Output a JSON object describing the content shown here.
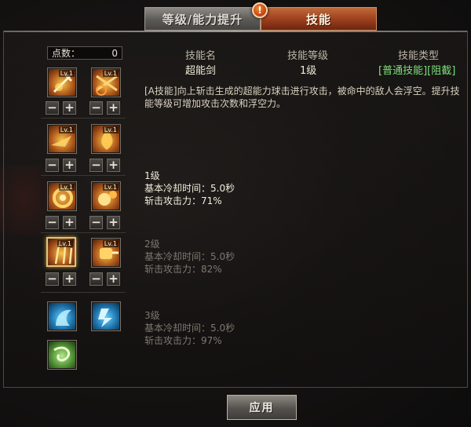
{
  "tabs": {
    "upgrade_label": "等级/能力提升",
    "skills_label": "技能",
    "alert": "!"
  },
  "points": {
    "label": "点数：",
    "value": "0"
  },
  "skill_info": {
    "name_header": "技能名",
    "level_header": "技能等级",
    "type_header": "技能类型",
    "name_value": "超能剑",
    "level_value": "1级",
    "type_value": "[普通技能][阻截]",
    "description": "[A技能]向上斩击生成的超能力球击进行攻击，被命中的敌人会浮空。提升技能等级可增加攻击次数和浮空力。"
  },
  "levels": [
    {
      "title": "1级",
      "cooldown": "基本冷却时间：5.0秒",
      "attack": "斩击攻击力：71%"
    },
    {
      "title": "2级",
      "cooldown": "基本冷却时间：5.0秒",
      "attack": "斩击攻击力：82%"
    },
    {
      "title": "3级",
      "cooldown": "基本冷却时间：5.0秒",
      "attack": "斩击攻击力：97%"
    }
  ],
  "skill_icons": [
    {
      "name": "skill-1",
      "level": "Lv.1",
      "color": "fire"
    },
    {
      "name": "skill-2",
      "level": "Lv.1",
      "color": "fire"
    },
    {
      "name": "skill-3",
      "level": "Lv.1",
      "color": "fire"
    },
    {
      "name": "skill-4",
      "level": "Lv.1",
      "color": "fire"
    },
    {
      "name": "skill-5",
      "level": "Lv.1",
      "color": "fire"
    },
    {
      "name": "skill-6",
      "level": "Lv.1",
      "color": "fire"
    },
    {
      "name": "skill-7",
      "level": "Lv.1",
      "color": "fire"
    },
    {
      "name": "skill-8",
      "level": "Lv.1",
      "color": "fire"
    },
    {
      "name": "skill-9",
      "level": "",
      "color": "blue"
    },
    {
      "name": "skill-10",
      "level": "",
      "color": "blue"
    },
    {
      "name": "skill-11",
      "level": "",
      "color": "green"
    }
  ],
  "buttons": {
    "minus": "−",
    "plus": "+",
    "apply": "应用"
  },
  "colors": {
    "tab_active": "#9b3d1d",
    "type_text": "#7ee07a",
    "selected_border": "#e2c47a"
  }
}
